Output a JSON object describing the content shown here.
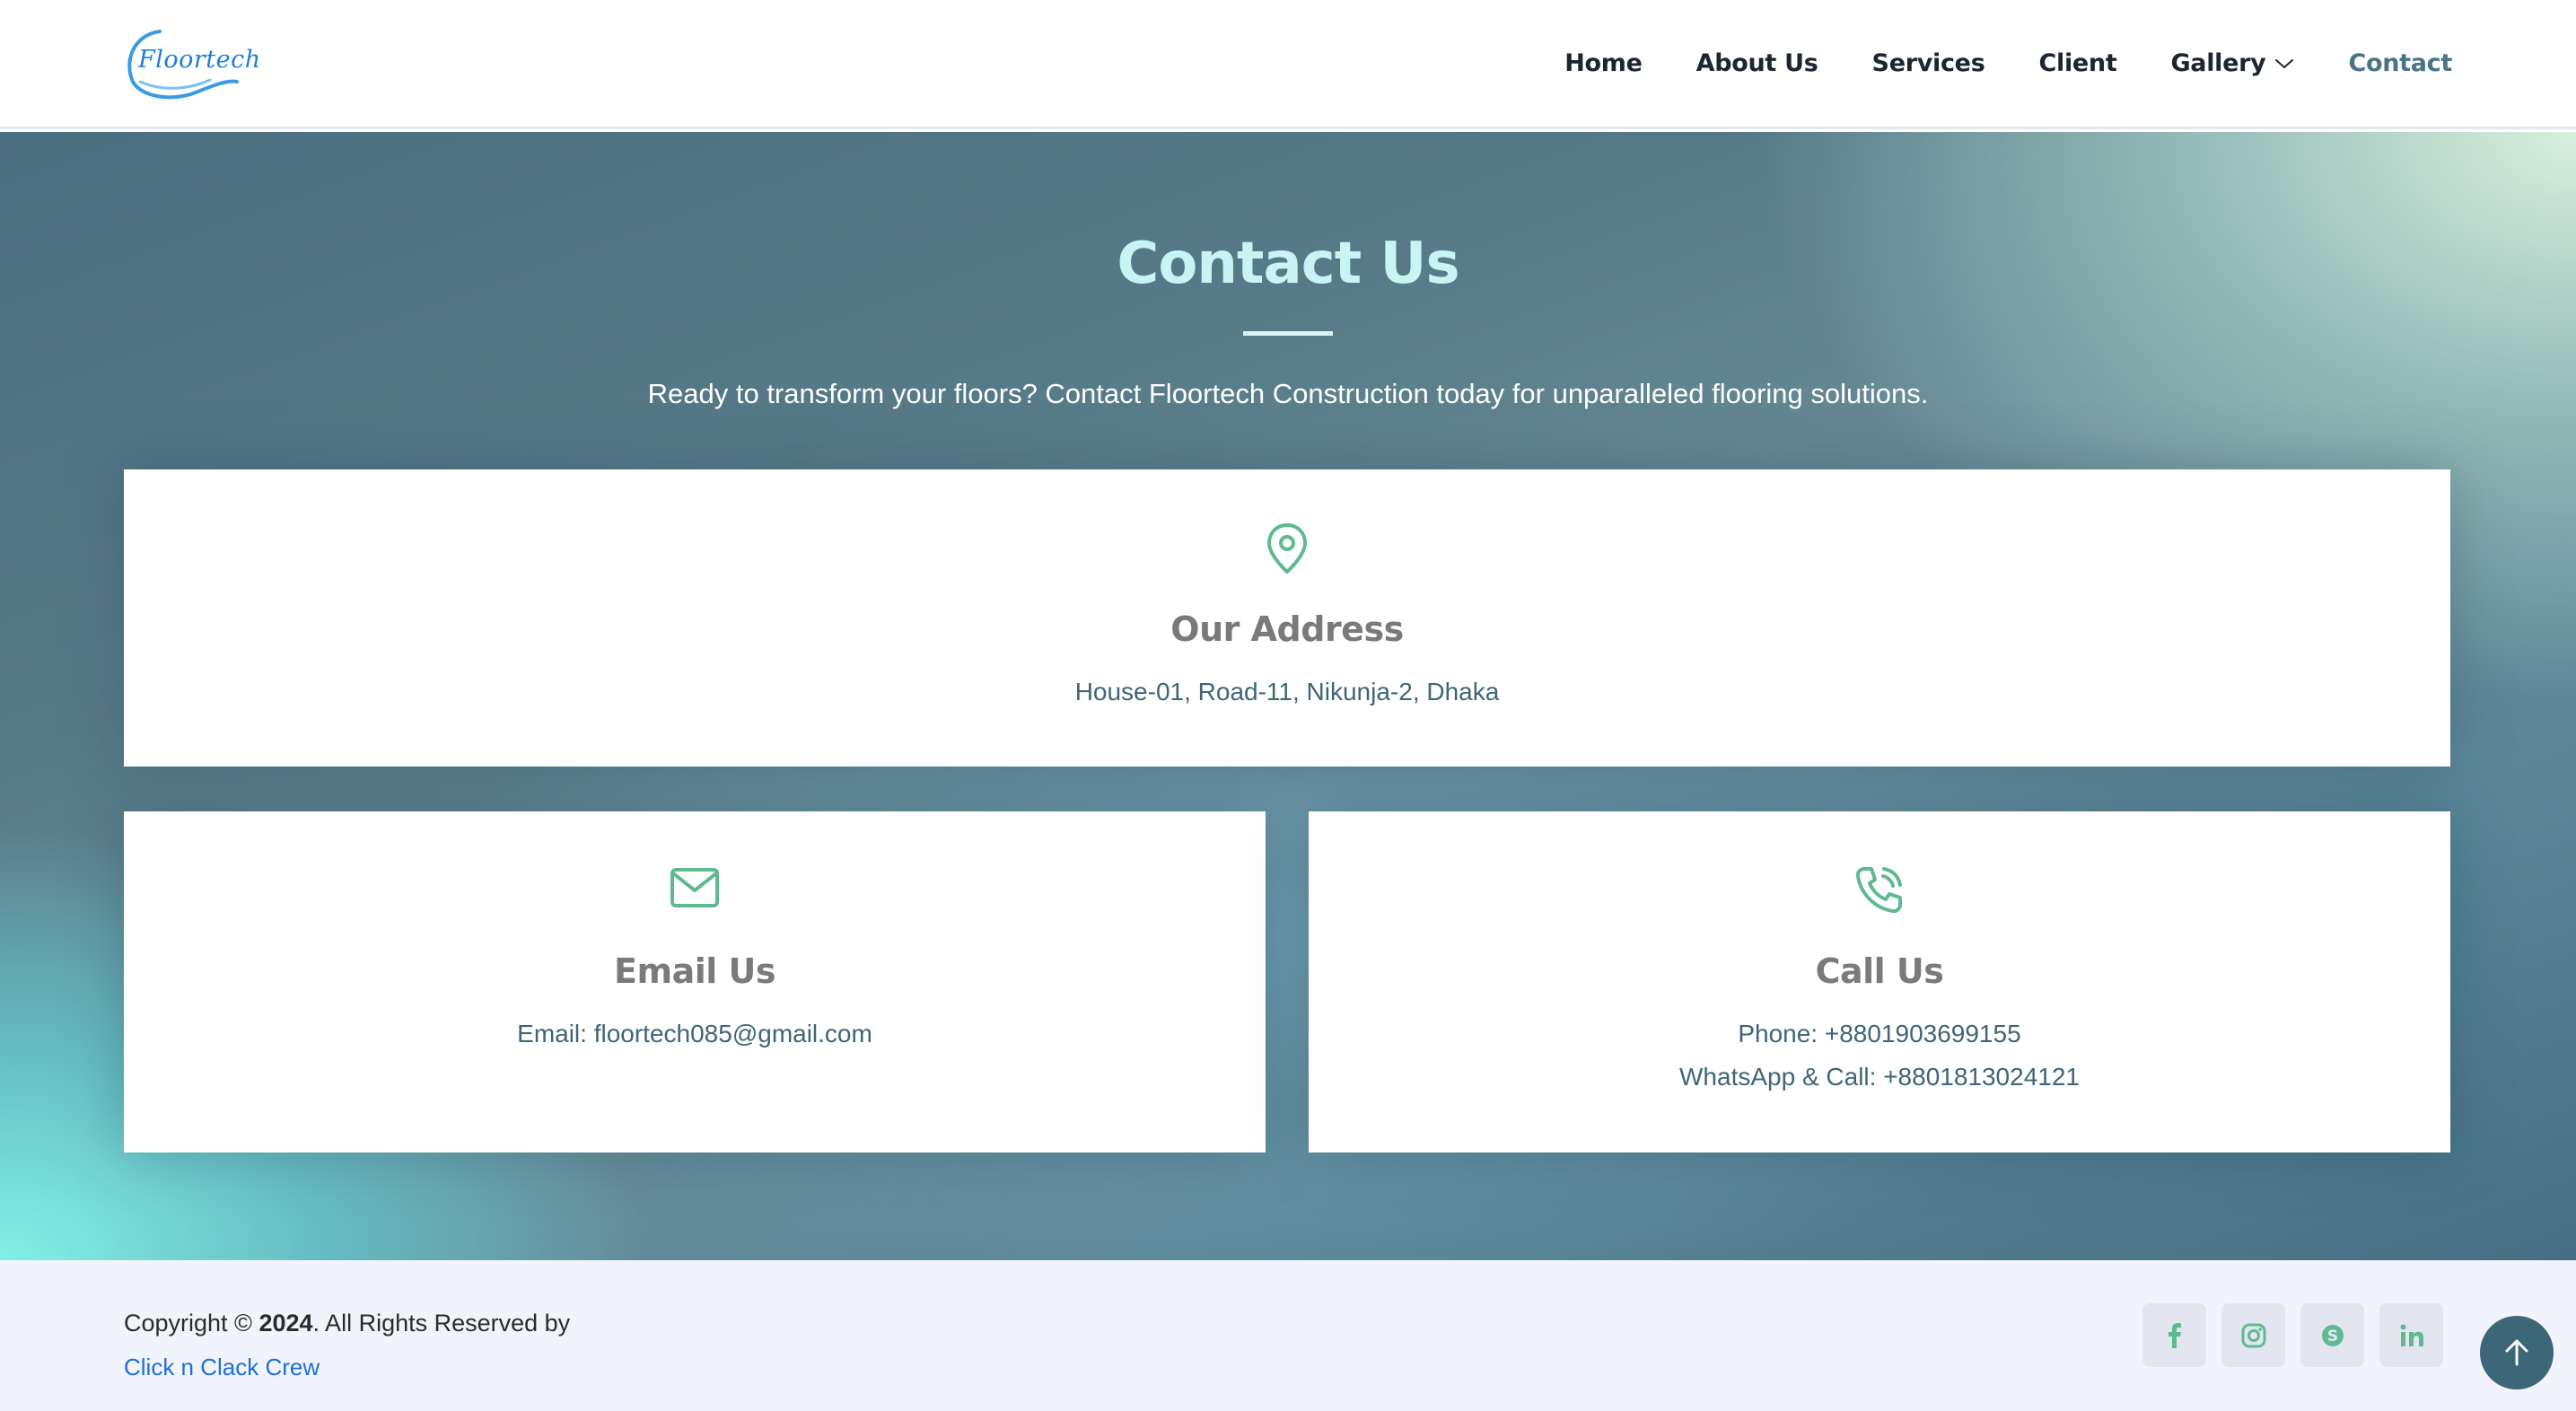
{
  "header": {
    "logo_text": "Floortech",
    "nav": [
      {
        "label": "Home"
      },
      {
        "label": "About Us"
      },
      {
        "label": "Services"
      },
      {
        "label": "Client"
      },
      {
        "label": "Gallery"
      },
      {
        "label": "Contact"
      }
    ],
    "active_item": "Contact"
  },
  "hero": {
    "title": "Contact Us",
    "subtitle": "Ready to transform your floors? Contact Floortech Construction today for unparalleled flooring solutions."
  },
  "cards": {
    "address": {
      "icon": "map-pin-icon",
      "title": "Our Address",
      "line1": "House-01, Road-11, Nikunja-2, Dhaka"
    },
    "email": {
      "icon": "envelope-icon",
      "title": "Email Us",
      "line1": "Email: floortech085@gmail.com"
    },
    "call": {
      "icon": "phone-icon",
      "title": "Call Us",
      "line1": "Phone: +8801903699155",
      "line2": "WhatsApp & Call: +8801813024121"
    }
  },
  "footer": {
    "copyright_prefix": "Copyright ©",
    "year": "2024",
    "copyright_suffix": ". All Rights Reserved by",
    "credit": "Click n Clack Crew",
    "socials": [
      "facebook-icon",
      "instagram-icon",
      "skype-icon",
      "linkedin-icon"
    ]
  },
  "colors": {
    "accent_green": "#5fbb8f",
    "nav_active": "#4a7386",
    "link_blue": "#1e6fd9",
    "scroll_top_bg": "#3d6678"
  }
}
